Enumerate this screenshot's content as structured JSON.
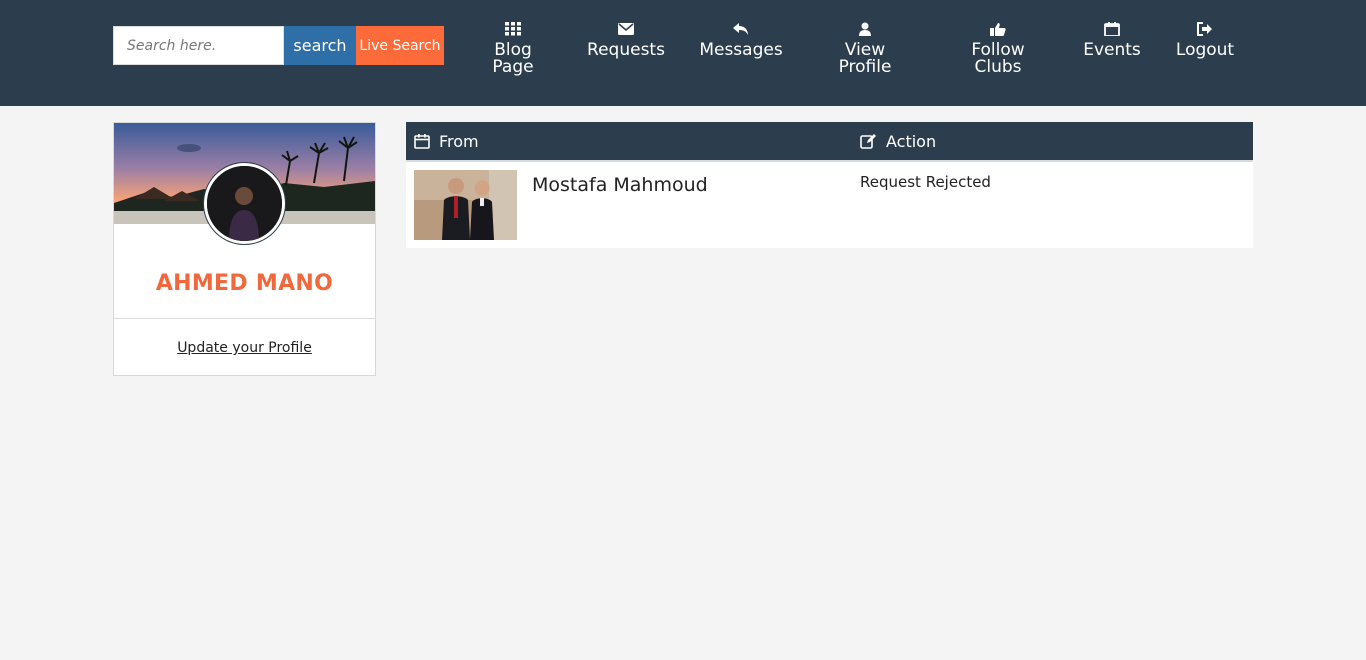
{
  "search": {
    "placeholder": "Search here.",
    "button_label": "search",
    "live_label": "Live Search"
  },
  "nav": {
    "blog": {
      "line1": "Blog",
      "line2": "Page",
      "icon": "grid-icon"
    },
    "requests": {
      "label": "Requests",
      "icon": "envelope-icon"
    },
    "messages": {
      "label": "Messages",
      "icon": "reply-icon"
    },
    "profile": {
      "line1": "View",
      "line2": "Profile",
      "icon": "user-icon"
    },
    "clubs": {
      "line1": "Follow",
      "line2": "Clubs",
      "icon": "thumbs-up-icon"
    },
    "events": {
      "label": "Events",
      "icon": "calendar-icon"
    },
    "logout": {
      "label": "Logout",
      "icon": "sign-out-icon"
    }
  },
  "profile": {
    "name": "AHMED MANO",
    "update_link": "Update your Profile"
  },
  "table": {
    "headers": {
      "from": "From",
      "action": "Action"
    },
    "rows": [
      {
        "name": "Mostafa Mahmoud",
        "action": "Request Rejected"
      }
    ]
  },
  "colors": {
    "header_bg": "#2c3e4e",
    "accent_orange": "#fd6b3a",
    "search_blue": "#2f6fa8",
    "page_bg": "#f4f4f4"
  }
}
